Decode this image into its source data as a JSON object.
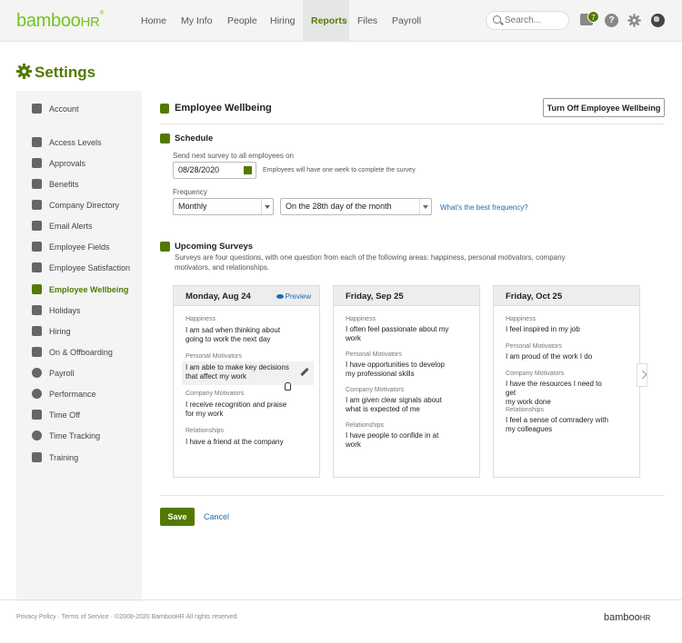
{
  "brand": {
    "logo_main": "bamboo",
    "logo_hr": "HR",
    "accent_color": "#527a00",
    "logo_color": "#73c41d",
    "link_color": "#1f6bb3"
  },
  "nav": {
    "items": [
      {
        "label": "Home"
      },
      {
        "label": "My Info"
      },
      {
        "label": "People"
      },
      {
        "label": "Hiring"
      },
      {
        "label": "Reports"
      },
      {
        "label": "Files"
      },
      {
        "label": "Payroll"
      }
    ],
    "active": "Reports",
    "search_placeholder": "Search...",
    "inbox_count": "7",
    "help_label": "?"
  },
  "page": {
    "title": "Settings",
    "icon": "gear-icon"
  },
  "sidebar": {
    "items": [
      {
        "label": "Account",
        "icon": "wrench-icon"
      },
      {
        "label": "Access Levels",
        "icon": "lock-icon"
      },
      {
        "label": "Approvals",
        "icon": "thumbs-up-icon"
      },
      {
        "label": "Benefits",
        "icon": "heart-icon"
      },
      {
        "label": "Company Directory",
        "icon": "directory-icon"
      },
      {
        "label": "Email Alerts",
        "icon": "email-icon"
      },
      {
        "label": "Employee Fields",
        "icon": "fields-icon"
      },
      {
        "label": "Employee Satisfaction",
        "icon": "smile-icon"
      },
      {
        "label": "Employee Wellbeing",
        "icon": "wellbeing-icon"
      },
      {
        "label": "Holidays",
        "icon": "gift-icon"
      },
      {
        "label": "Hiring",
        "icon": "hiring-icon"
      },
      {
        "label": "On & Offboarding",
        "icon": "onboarding-icon"
      },
      {
        "label": "Payroll",
        "icon": "dollar-icon"
      },
      {
        "label": "Performance",
        "icon": "performance-icon"
      },
      {
        "label": "Time Off",
        "icon": "time-off-icon"
      },
      {
        "label": "Time Tracking",
        "icon": "stopwatch-icon"
      },
      {
        "label": "Training",
        "icon": "graduation-cap-icon"
      }
    ],
    "active": "Employee Wellbeing"
  },
  "main": {
    "title": "Employee Wellbeing",
    "turn_off_label": "Turn Off Employee Wellbeing",
    "schedule": {
      "title": "Schedule",
      "send_label": "Send next survey to all employees on",
      "date_value": "08/28/2020",
      "date_hint": "Employees will have one week to complete the survey",
      "frequency_label": "Frequency",
      "frequency_value": "Monthly",
      "day_value": "On the 28th day of the month",
      "help_link": "What's the best frequency?"
    },
    "upcoming": {
      "title": "Upcoming Surveys",
      "description_line1": "Surveys are four questions, with one question from each of the following areas: happiness, personal motivators, company",
      "description_line2": "motivators, and relationships.",
      "preview_label": "Preview",
      "cards": [
        {
          "date": "Monday, Aug 24",
          "questions": [
            {
              "category": "Happiness",
              "line1": "I am sad when thinking about",
              "line2": "going to work the next day"
            },
            {
              "category": "Personal Motivators",
              "line1": "I am able to make key decisions",
              "line2": "that affect my work"
            },
            {
              "category": "Company Motivators",
              "line1": "I receive recognition and praise",
              "line2": "for my work"
            },
            {
              "category": "Relationships",
              "line1": "I have a friend at the company",
              "line2": ""
            }
          ]
        },
        {
          "date": "Friday, Sep 25",
          "questions": [
            {
              "category": "Happiness",
              "line1": "I often feel passionate about my",
              "line2": "work"
            },
            {
              "category": "Personal Motivators",
              "line1": "I have opportunities to develop",
              "line2": "my professional skills"
            },
            {
              "category": "Company Motivators",
              "line1": "I am given clear signals about",
              "line2": "what is expected of me"
            },
            {
              "category": "Relationships",
              "line1": "I have people to confide in at",
              "line2": "work"
            }
          ]
        },
        {
          "date": "Friday, Oct 25",
          "questions": [
            {
              "category": "Happiness",
              "line1": "I feel inspired in my job",
              "line2": ""
            },
            {
              "category": "Personal Motivators",
              "line1": "I am proud of the work I do",
              "line2": ""
            },
            {
              "category": "Company Motivators",
              "line1": "I have the resources I need to get",
              "line2": "my work done"
            },
            {
              "category": "Relationships",
              "line1": "I feel a sense of comradery with",
              "line2": "my colleagues"
            }
          ]
        }
      ]
    },
    "save_label": "Save",
    "cancel_label": "Cancel"
  },
  "footer": {
    "links": "Privacy Policy · Terms of Service · ©2008-2020 BambooHR All rights reserved.",
    "logo_main": "bamboo",
    "logo_hr": "HR"
  }
}
